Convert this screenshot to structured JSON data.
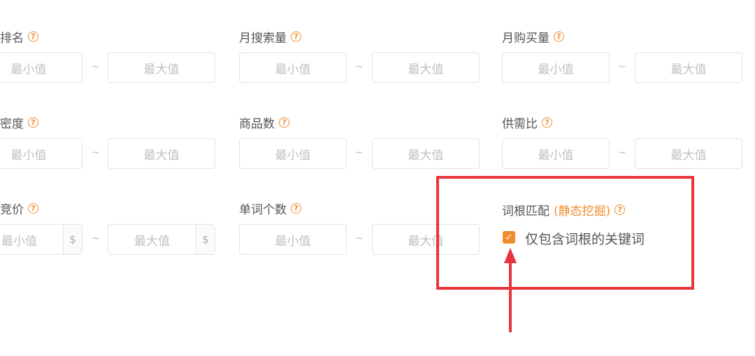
{
  "placeholders": {
    "min": "最小值",
    "max": "最大值"
  },
  "range_separator": "~",
  "currency_symbol": "$",
  "help_icon_glyph": "?",
  "filters": {
    "rank": {
      "label": "排名"
    },
    "monthly_search": {
      "label": "月搜索量"
    },
    "monthly_purchase": {
      "label": "月购买量"
    },
    "density": {
      "label": "密度"
    },
    "product_count": {
      "label": "商品数"
    },
    "supply_demand": {
      "label": "供需比"
    },
    "bid": {
      "label": "竞价"
    },
    "word_count": {
      "label": "单词个数"
    }
  },
  "root_match": {
    "label": "词根匹配",
    "tag": "(静态挖掘)",
    "checkbox_label": "仅包含词根的关键词",
    "checked": true
  },
  "annotation": {
    "color": "#e9343a"
  },
  "colors": {
    "accent": "#f08c2e",
    "border": "#e3e3e3",
    "placeholder": "#c0c0c0"
  }
}
